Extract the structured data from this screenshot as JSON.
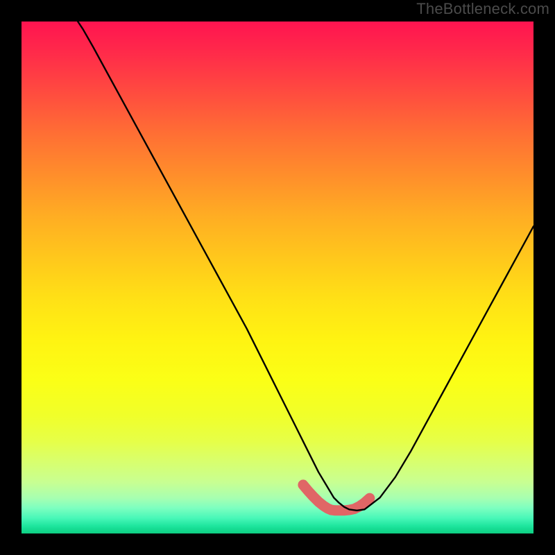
{
  "watermark": {
    "text": "TheBottleneck.com"
  },
  "chart_data": {
    "type": "line",
    "title": "",
    "xlabel": "",
    "ylabel": "",
    "xlim": [
      0,
      100
    ],
    "ylim": [
      0,
      100
    ],
    "series": [
      {
        "name": "bottleneck-curve",
        "x": [
          11,
          12,
          14,
          17,
          20,
          23,
          26,
          29,
          32,
          35,
          38,
          41,
          44,
          46,
          48,
          50,
          52,
          53.5,
          55,
          56,
          57,
          58,
          59.5,
          61,
          62,
          63,
          64,
          65.5,
          67,
          70,
          73,
          76,
          79,
          82,
          85,
          88,
          91,
          94,
          97,
          100
        ],
        "y": [
          100,
          98.5,
          95,
          89.5,
          84,
          78.5,
          73,
          67.5,
          62,
          56.5,
          51,
          45.5,
          40,
          36,
          32,
          28,
          24,
          21,
          18,
          16,
          14,
          12,
          9.5,
          7,
          6,
          5.2,
          4.7,
          4.5,
          4.7,
          7,
          11,
          16,
          21.5,
          27,
          32.5,
          38,
          43.5,
          49,
          54.5,
          60
        ]
      },
      {
        "name": "valley-highlight",
        "x": [
          55,
          56,
          57,
          58,
          59,
          59.8,
          60.5,
          61.3,
          62.2,
          63,
          64,
          65,
          66,
          67,
          68
        ],
        "y": [
          9.5,
          8.3,
          7.2,
          6.2,
          5.4,
          4.9,
          4.6,
          4.5,
          4.5,
          4.5,
          4.6,
          4.8,
          5.3,
          6,
          6.9
        ]
      }
    ],
    "gradient_stops": [
      {
        "pos": 0,
        "color": "#ff1450"
      },
      {
        "pos": 0.3,
        "color": "#ff8e2b"
      },
      {
        "pos": 0.62,
        "color": "#fff312"
      },
      {
        "pos": 0.9,
        "color": "#c8ff92"
      },
      {
        "pos": 1.0,
        "color": "#0ecf82"
      }
    ]
  }
}
